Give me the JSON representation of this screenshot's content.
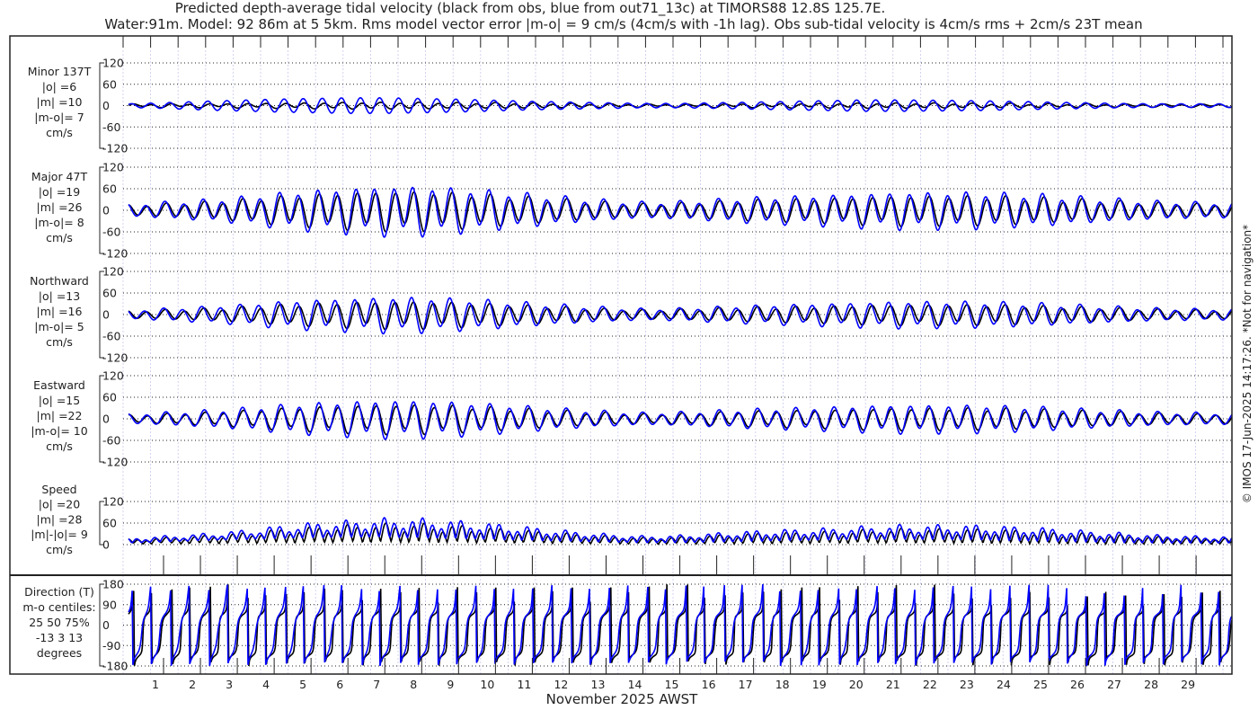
{
  "title_line1": "Predicted depth-average tidal velocity (black from obs, blue from out71_13c) at TIMORS88 12.8S 125.7E.",
  "title_line2": "Water:91m. Model: 92 86m at 5 5km. Rms model vector error |m-o| = 9 cm/s (4cm/s with -1h lag). Obs sub-tidal velocity is 4cm/s rms + 2cm/s 23T mean",
  "copyright": "© IMOS 17-Jun-2025 14:17:26. *Not for navigation*",
  "colors": {
    "obs": "#000000",
    "model": "#0000ff"
  },
  "chart_data": {
    "type": "line",
    "xlabel": "November 2025 AWST",
    "x_ticks": [
      "1",
      "2",
      "3",
      "4",
      "5",
      "6",
      "7",
      "8",
      "9",
      "10",
      "11",
      "12",
      "13",
      "14",
      "15",
      "16",
      "17",
      "18",
      "19",
      "20",
      "21",
      "22",
      "23",
      "24",
      "25",
      "26",
      "27",
      "28",
      "29"
    ],
    "xlim_days": [
      0,
      30
    ],
    "series_names": [
      "obs",
      "model"
    ],
    "envelope_days": [
      0,
      1,
      2,
      3,
      4,
      5,
      6,
      7,
      8,
      9,
      10,
      11,
      12,
      13,
      14,
      15,
      16,
      17,
      18,
      19,
      20,
      21,
      22,
      23,
      24,
      25,
      26,
      27,
      28,
      29,
      30
    ],
    "major_amp_model": [
      15,
      20,
      25,
      32,
      42,
      50,
      55,
      60,
      60,
      55,
      48,
      40,
      32,
      25,
      20,
      22,
      27,
      32,
      35,
      38,
      42,
      45,
      45,
      45,
      42,
      38,
      32,
      27,
      22,
      20,
      18
    ],
    "major_amp_obs": [
      12,
      16,
      20,
      26,
      34,
      40,
      45,
      48,
      48,
      44,
      38,
      32,
      26,
      20,
      16,
      18,
      22,
      26,
      28,
      30,
      34,
      36,
      36,
      36,
      34,
      30,
      26,
      22,
      18,
      16,
      15
    ],
    "minor_amp_model": [
      5,
      8,
      12,
      15,
      18,
      20,
      22,
      22,
      20,
      18,
      15,
      12,
      10,
      8,
      6,
      6,
      8,
      10,
      12,
      14,
      16,
      16,
      15,
      14,
      12,
      10,
      8,
      6,
      5,
      5,
      5
    ],
    "minor_amp_obs": [
      3,
      4,
      4,
      5,
      6,
      7,
      8,
      8,
      8,
      7,
      7,
      6,
      5,
      4,
      3,
      3,
      4,
      4,
      5,
      5,
      6,
      6,
      6,
      5,
      5,
      4,
      4,
      3,
      3,
      3,
      3
    ],
    "panels": [
      {
        "id": "minor",
        "labels": [
          "Minor 137T",
          "|o| =6",
          "|m| =10",
          "|m-o|= 7",
          "cm/s"
        ],
        "yticks": [
          "120",
          "60",
          "0",
          "-60",
          "-120"
        ],
        "ylim": [
          -120,
          120
        ]
      },
      {
        "id": "major",
        "labels": [
          "Major 47T",
          "|o| =19",
          "|m| =26",
          "|m-o|= 8",
          "cm/s"
        ],
        "yticks": [
          "120",
          "60",
          "0",
          "-60",
          "-120"
        ],
        "ylim": [
          -120,
          120
        ]
      },
      {
        "id": "north",
        "labels": [
          "Northward",
          "|o| =13",
          "|m| =16",
          "|m-o|= 5",
          "cm/s"
        ],
        "yticks": [
          "120",
          "60",
          "0",
          "-60",
          "-120"
        ],
        "ylim": [
          -120,
          120
        ]
      },
      {
        "id": "east",
        "labels": [
          "Eastward",
          "|o| =15",
          "|m| =22",
          "|m-o|= 10",
          "cm/s"
        ],
        "yticks": [
          "120",
          "60",
          "0",
          "-60",
          "-120"
        ],
        "ylim": [
          -120,
          120
        ]
      },
      {
        "id": "speed",
        "labels": [
          "Speed",
          "|o| =20",
          "|m| =28",
          "|m|-|o|= 9",
          "cm/s"
        ],
        "yticks": [
          "120",
          "60",
          "0"
        ],
        "ylim": [
          0,
          120
        ]
      },
      {
        "id": "dir",
        "labels": [
          "Direction (T)",
          "m-o centiles:",
          "25  50  75%",
          "-13   3  13",
          "degrees"
        ],
        "yticks": [
          "180",
          "90",
          "0",
          "-90",
          "-180"
        ],
        "ylim": [
          -180,
          180
        ]
      }
    ]
  }
}
